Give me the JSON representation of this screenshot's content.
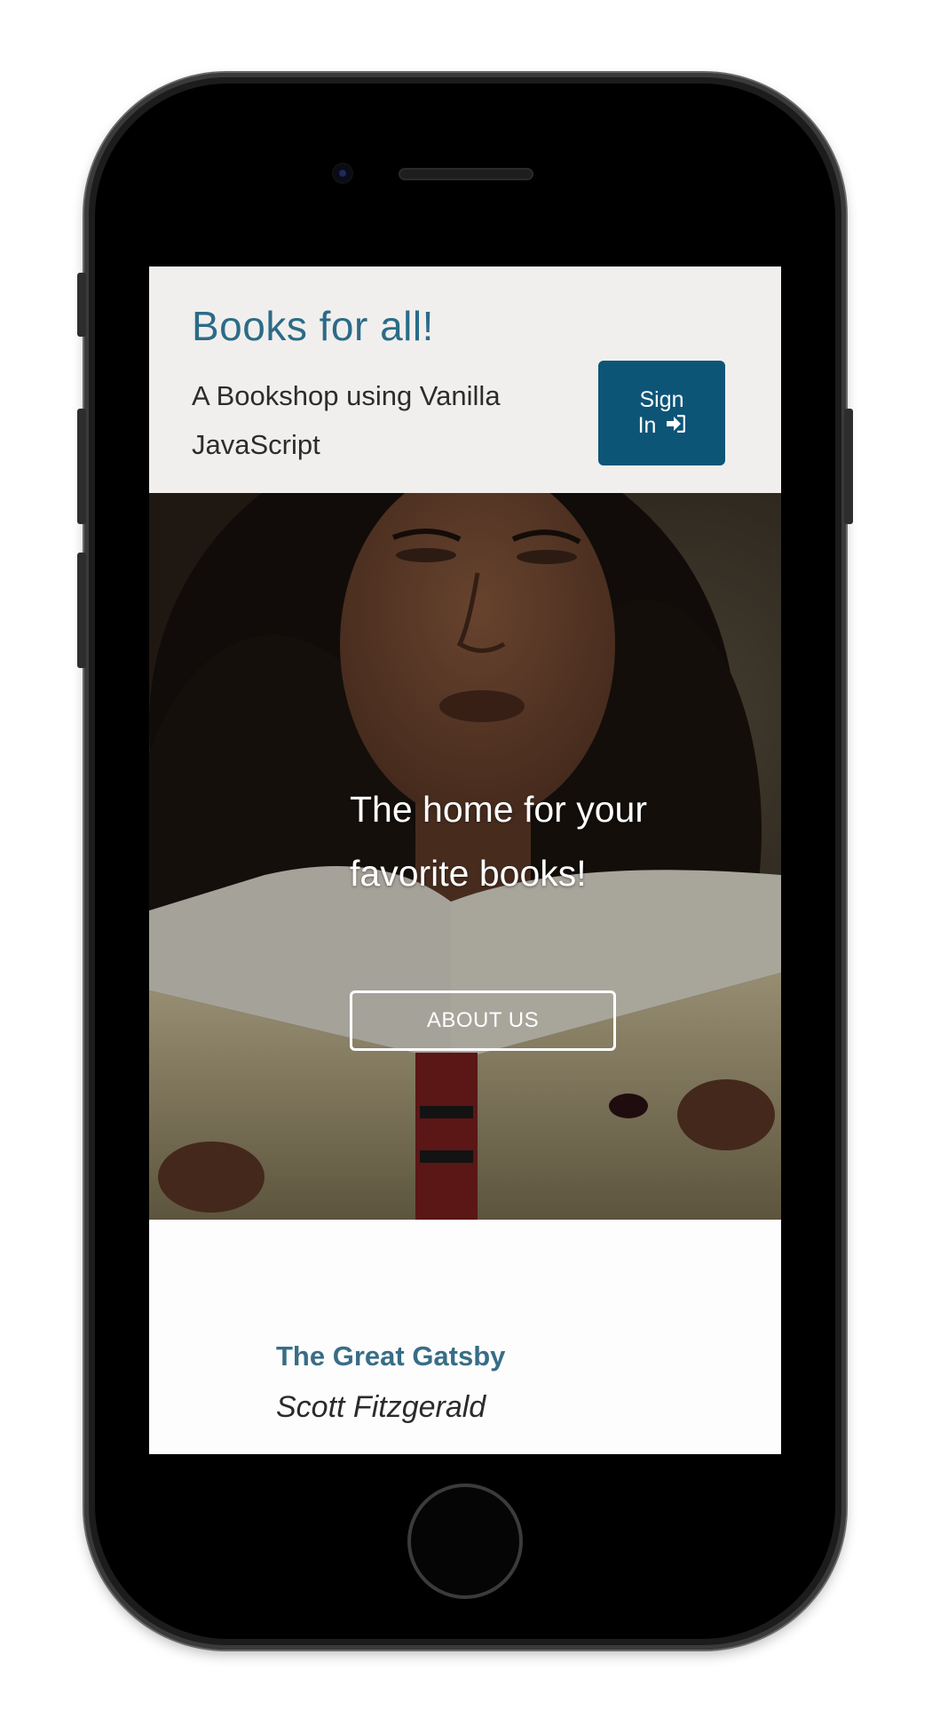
{
  "header": {
    "title": "Books for all!",
    "subtitle": "A Bookshop using Vanilla JavaScript",
    "sign_in_label_line1": "Sign",
    "sign_in_label_line2": "In",
    "sign_in_icon": "sign-in-arrow-icon"
  },
  "hero": {
    "image": "woman-reading-book-photo",
    "heading": "The home for your favorite books!",
    "button_label": "ABOUT US"
  },
  "books": [
    {
      "title": "The Great Gatsby",
      "author": "Scott Fitzgerald"
    }
  ],
  "colors": {
    "brand_title": "#2b6b88",
    "primary_button": "#0d5577",
    "header_bg": "#f1efed",
    "book_title": "#2e6680"
  }
}
